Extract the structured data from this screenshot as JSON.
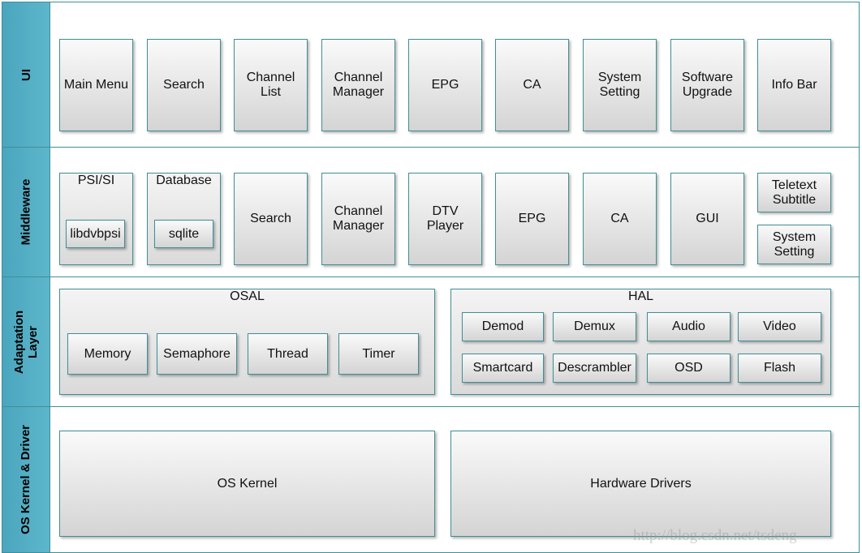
{
  "layers": {
    "ui": "UI",
    "middleware": "Middleware",
    "adaptation": "Adaptation Layer",
    "os": "OS Kernel & Driver"
  },
  "ui": [
    "Main Menu",
    "Search",
    "Channel List",
    "Channel Manager",
    "EPG",
    "CA",
    "System Setting",
    "Software Upgrade",
    "Info Bar"
  ],
  "middleware": {
    "psi": "PSI/SI",
    "libdvbpsi": "libdvbpsi",
    "database": "Database",
    "sqlite": "sqlite",
    "items": [
      "Search",
      "Channel Manager",
      "DTV Player",
      "EPG",
      "CA",
      "GUI"
    ],
    "teletext": "Teletext Subtitle",
    "system_setting": "System Setting"
  },
  "osal": {
    "title": "OSAL",
    "items": [
      "Memory",
      "Semaphore",
      "Thread",
      "Timer"
    ]
  },
  "hal": {
    "title": "HAL",
    "items": [
      "Demod",
      "Demux",
      "Audio",
      "Video",
      "Smartcard",
      "Descrambler",
      "OSD",
      "Flash"
    ]
  },
  "os": {
    "kernel": "OS Kernel",
    "drivers": "Hardware Drivers"
  },
  "watermark": "http://blog.csdn.net/tsdeng",
  "colors": {
    "layer_bar": "#4aa6be",
    "border": "#3f8f96"
  }
}
